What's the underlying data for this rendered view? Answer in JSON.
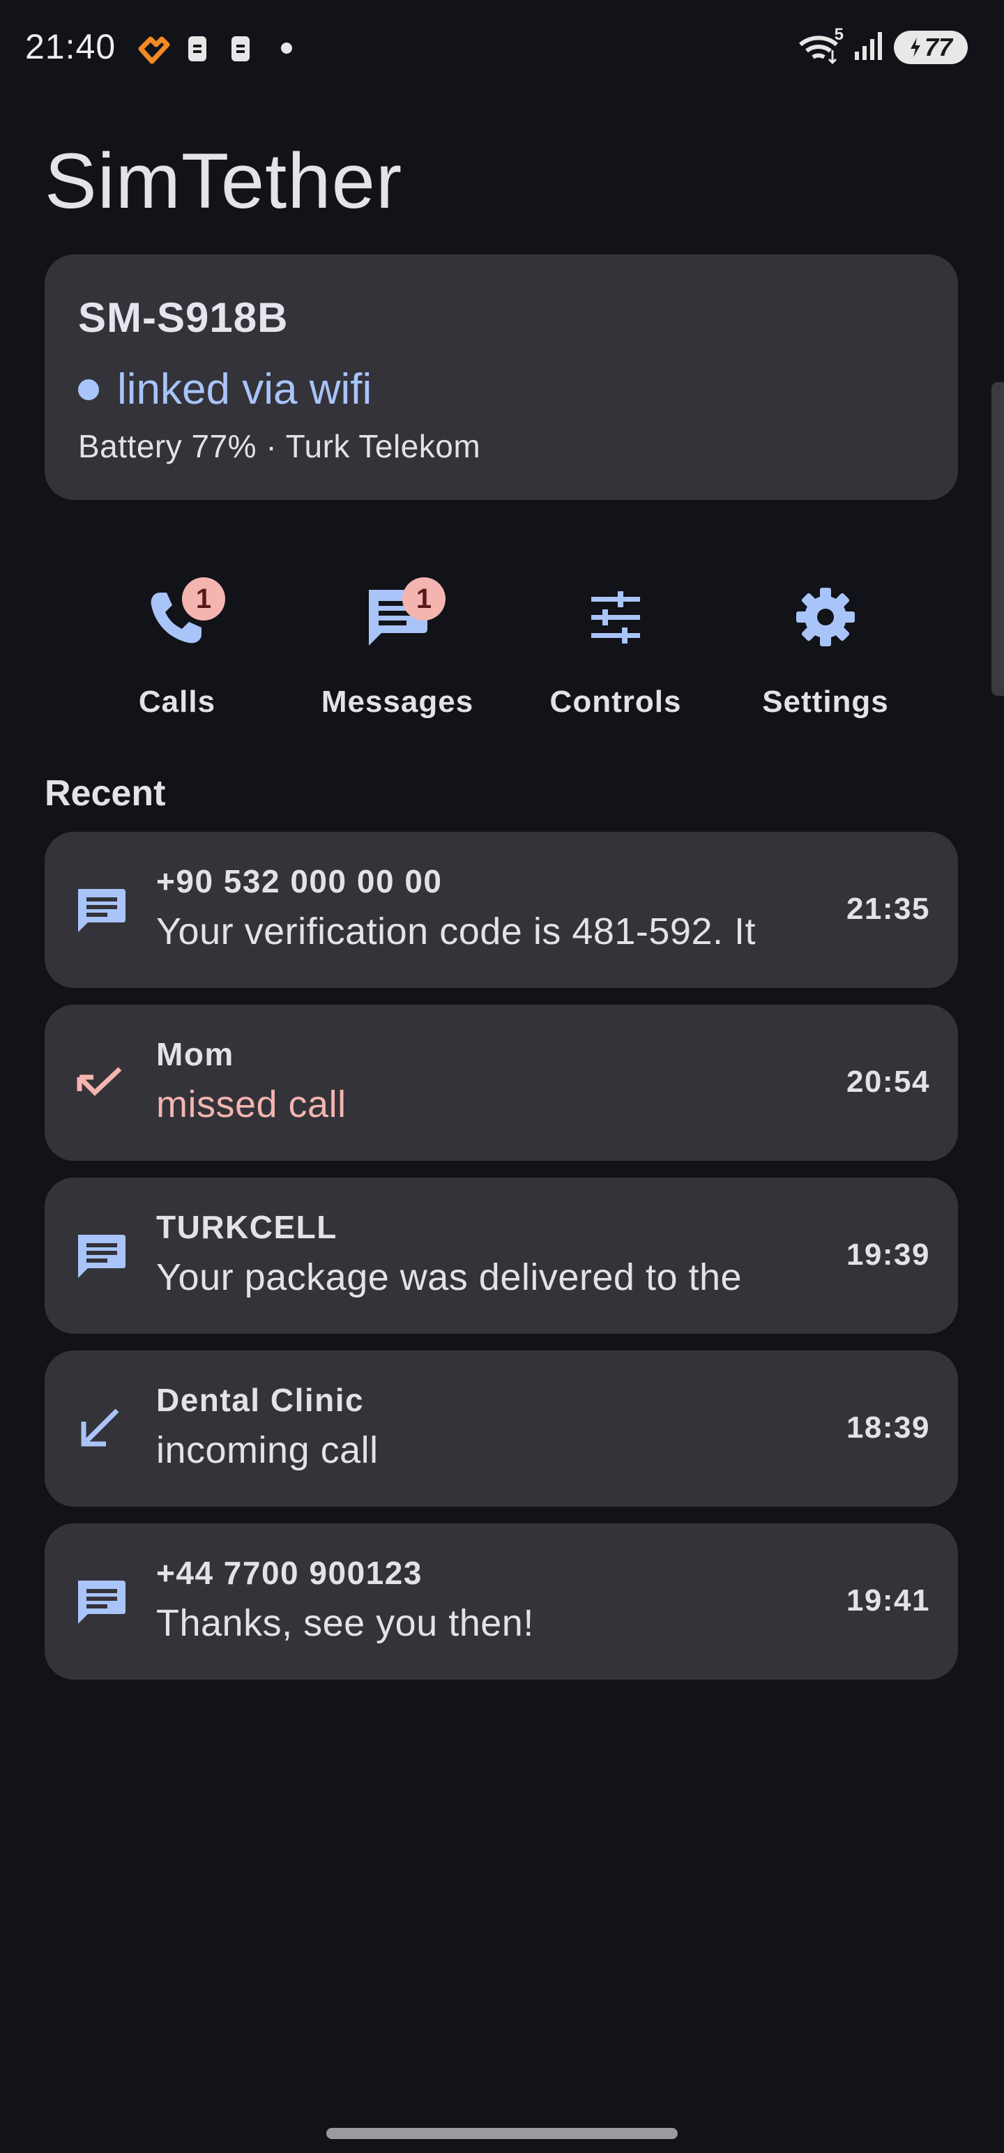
{
  "status_bar": {
    "time": "21:40",
    "wifi_label": "5",
    "battery": "77"
  },
  "app": {
    "title": "SimTether"
  },
  "device": {
    "name": "SM-S918B",
    "link_status": "linked via wifi",
    "info": "Battery 77% · Turk Telekom"
  },
  "actions": [
    {
      "label": "Calls",
      "icon": "phone-icon",
      "badge": "1"
    },
    {
      "label": "Messages",
      "icon": "message-icon",
      "badge": "1"
    },
    {
      "label": "Controls",
      "icon": "tune-icon"
    },
    {
      "label": "Settings",
      "icon": "gear-icon"
    }
  ],
  "recent": {
    "title": "Recent",
    "items": [
      {
        "type": "message",
        "icon": "message-icon",
        "who": "+90 532 000 00 00",
        "what": "Your verification code is 481-592. It",
        "time": "21:35"
      },
      {
        "type": "missed",
        "icon": "missed-call-icon",
        "who": "Mom",
        "what": "missed call",
        "time": "20:54"
      },
      {
        "type": "message",
        "icon": "message-icon",
        "who": "TURKCELL",
        "what": "Your package was delivered to the",
        "time": "19:39"
      },
      {
        "type": "incoming",
        "icon": "incoming-call-icon",
        "who": "Dental Clinic",
        "what": "incoming call",
        "time": "18:39"
      },
      {
        "type": "message",
        "icon": "message-icon",
        "who": "+44 7700 900123",
        "what": "Thanks, see you then!",
        "time": "19:41"
      }
    ]
  },
  "colors": {
    "background": "#121318",
    "card": "#333339",
    "accent": "#a8c4f8",
    "missed": "#f4b4b0"
  }
}
